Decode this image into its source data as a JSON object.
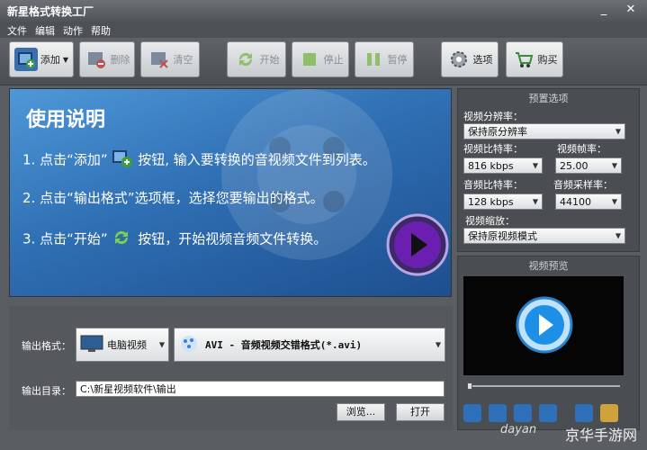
{
  "window": {
    "title": "新星格式转换工厂"
  },
  "menu": [
    "文件",
    "编辑",
    "动作",
    "帮助"
  ],
  "toolbar": {
    "add": "添加",
    "delete": "删除",
    "clear": "清空",
    "start": "开始",
    "stop": "停止",
    "pause": "暂停",
    "options": "选项",
    "buy": "购买"
  },
  "banner": {
    "title": "使用说明",
    "step1_a": "1. 点击“添加”",
    "step1_b": "按钮, 输入要转换的音视频文件到列表。",
    "step2": "2. 点击“输出格式”选项框，选择您要输出的格式。",
    "step3_a": "3. 点击“开始”",
    "step3_b": "按钮，开始视频音频文件转换。"
  },
  "output": {
    "format_label": "输出格式：",
    "category": "电脑视频",
    "format": "AVI - 音频视频交错格式(*.avi)",
    "dir_label": "输出目录：",
    "dir_value": "C:\\新星视频软件\\输出",
    "browse": "浏览...",
    "open": "打开"
  },
  "preset": {
    "title": "预置选项",
    "resolution_label": "视频分辨率：",
    "resolution": "保持原分辨率",
    "vbitrate_label": "视频比特率：",
    "vbitrate": "816 kbps",
    "framerate_label": "视频帧率：",
    "framerate": "25.00",
    "abitrate_label": "音频比特率：",
    "abitrate": "128 kbps",
    "samplerate_label": "音频采样率：",
    "samplerate": "44100",
    "scale_label": "视频缩放：",
    "scale": "保持原视频模式"
  },
  "preview": {
    "title": "视频预览"
  },
  "watermark": {
    "text": "京华手游网",
    "url": "dayan"
  },
  "colors": {
    "accent": "#2f6fb3",
    "play": "#6a1fb0"
  }
}
